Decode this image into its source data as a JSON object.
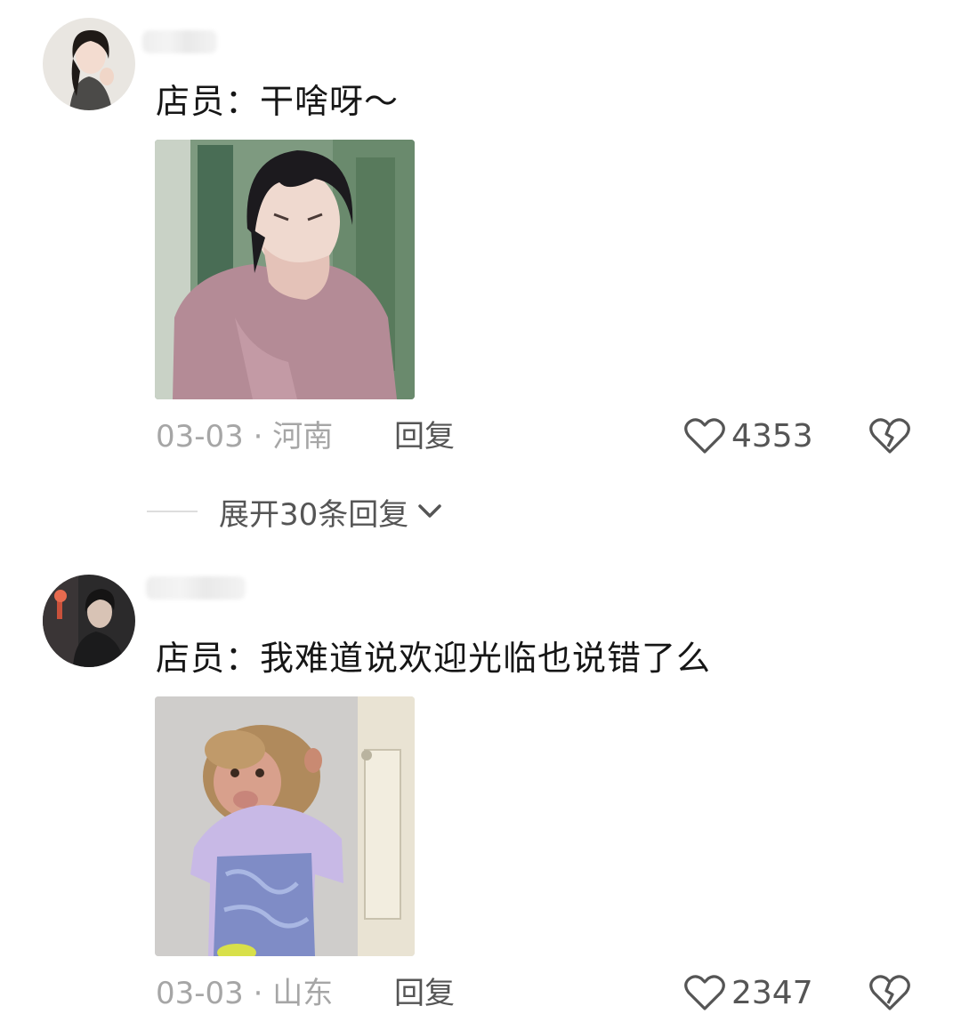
{
  "comments": [
    {
      "text": "店员：干啥呀～",
      "date": "03-03",
      "separator": "·",
      "location": "河南",
      "reply_label": "回复",
      "likes": "4353",
      "expand_replies": "展开30条回复"
    },
    {
      "text": "店员：我难道说欢迎光临也说错了么",
      "date": "03-03",
      "separator": "·",
      "location": "山东",
      "reply_label": "回复",
      "likes": "2347"
    }
  ],
  "icons": {
    "like": "heart-outline-icon",
    "dislike": "broken-heart-icon",
    "expand": "chevron-down-icon"
  },
  "colors": {
    "text": "#161616",
    "meta": "#a6a6a6",
    "action": "#555555"
  }
}
